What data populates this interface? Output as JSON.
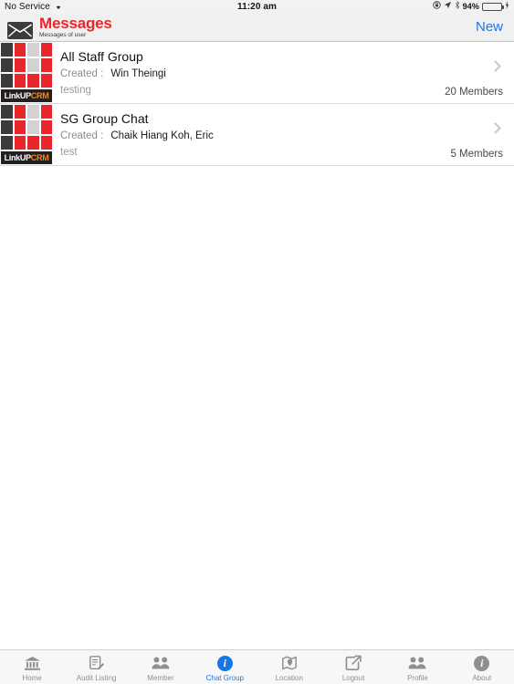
{
  "status_bar": {
    "carrier": "No Service",
    "wifi_icon": "wifi-icon",
    "time": "11:20 am",
    "rotation_lock_icon": "rotation-lock-icon",
    "location_icon": "location-arrow-icon",
    "bluetooth_icon": "bluetooth-icon",
    "battery_percent": "94%",
    "battery_level": 94,
    "charging_icon": "charging-bolt-icon"
  },
  "navbar": {
    "icon": "envelope-icon",
    "title": "Messages",
    "subtitle": "Messages of user",
    "action_label": "New",
    "title_color": "#e8262b",
    "action_color": "#1c76e8"
  },
  "logo": {
    "name_primary": "LinkUP",
    "name_accent": "CRM",
    "accent_color": "#f08a1e",
    "red": "#e8262b",
    "dark": "#3b3b3b",
    "gray": "#d2d2d2"
  },
  "list": {
    "created_label": "Created :",
    "rows": [
      {
        "avatar": "linkup-crm-logo",
        "title": "All Staff Group",
        "creator": "Win Theingi",
        "preview": "testing",
        "members": "20 Members"
      },
      {
        "avatar": "linkup-crm-logo",
        "title": "SG Group Chat",
        "creator": "Chaik Hiang Koh, Eric",
        "preview": "test",
        "members": "5 Members"
      }
    ]
  },
  "tabbar": {
    "active_index": 3,
    "tabs": [
      {
        "label": "Home",
        "icon": "home-bank-icon"
      },
      {
        "label": "Audit Listing",
        "icon": "clipboard-pencil-icon"
      },
      {
        "label": "Member",
        "icon": "people-icon"
      },
      {
        "label": "Chat Group",
        "icon": "info-circle-icon"
      },
      {
        "label": "Location",
        "icon": "map-pin-icon"
      },
      {
        "label": "Logout",
        "icon": "logout-arrow-icon"
      },
      {
        "label": "Profile",
        "icon": "people-icon"
      },
      {
        "label": "About",
        "icon": "info-circle-icon"
      }
    ]
  }
}
